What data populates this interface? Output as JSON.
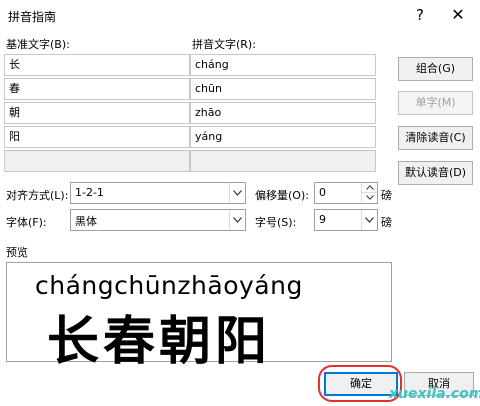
{
  "window": {
    "title": "拼音指南",
    "help": "?",
    "close": "✕"
  },
  "base_text_label": "基准文字(B):",
  "pinyin_label": "拼音文字(R):",
  "rows": [
    {
      "base": "长",
      "pinyin": "cháng"
    },
    {
      "base": "春",
      "pinyin": "chūn"
    },
    {
      "base": "朝",
      "pinyin": "zhāo"
    },
    {
      "base": "阳",
      "pinyin": "yáng"
    }
  ],
  "side_buttons": {
    "group": "组合(G)",
    "single": "单字(M)",
    "clear": "清除读音(C)",
    "default_reading": "默认读音(D)"
  },
  "options": {
    "align_label": "对齐方式(L):",
    "align_value": "1-2-1",
    "offset_label": "偏移量(O):",
    "offset_value": "0",
    "offset_unit": "磅",
    "font_label": "字体(F):",
    "font_value": "黑体",
    "size_label": "字号(S):",
    "size_value": "9",
    "size_unit": "磅"
  },
  "preview": {
    "label": "预览",
    "pinyin": "chángchūnzhāoyáng",
    "hanzi": "长春朝阳"
  },
  "footer": {
    "ok": "确定",
    "cancel": "取消"
  },
  "watermark": "xuexila.com",
  "colors": {
    "highlight": "#e03030",
    "default_button_border": "#0078d7"
  }
}
